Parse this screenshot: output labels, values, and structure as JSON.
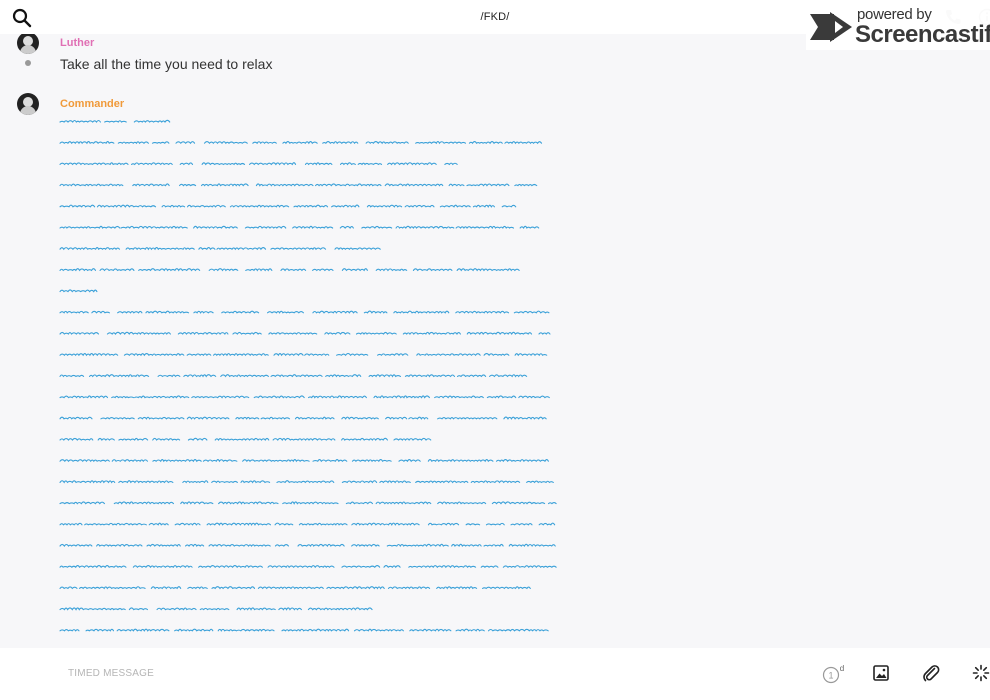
{
  "header": {
    "title": "/FKD/",
    "watermark_top": "powered by",
    "watermark_bottom": "Screencastify"
  },
  "messages": [
    {
      "sender": "Luther",
      "sender_color": "#e06fb4",
      "text": "Take all the time you need to relax"
    },
    {
      "sender": "Commander",
      "sender_color": "#f09a3a",
      "text": "",
      "scribble_lines": 25,
      "scribble_color": "#3aa0d8"
    }
  ],
  "composer": {
    "placeholder": "TIMED MESSAGE",
    "timer_value": "1",
    "timer_unit": "d"
  },
  "icons": [
    "search-icon",
    "phone-icon",
    "info-icon",
    "stopwatch-icon",
    "image-icon",
    "paperclip-icon",
    "burst-icon",
    "screencastify-logo"
  ]
}
